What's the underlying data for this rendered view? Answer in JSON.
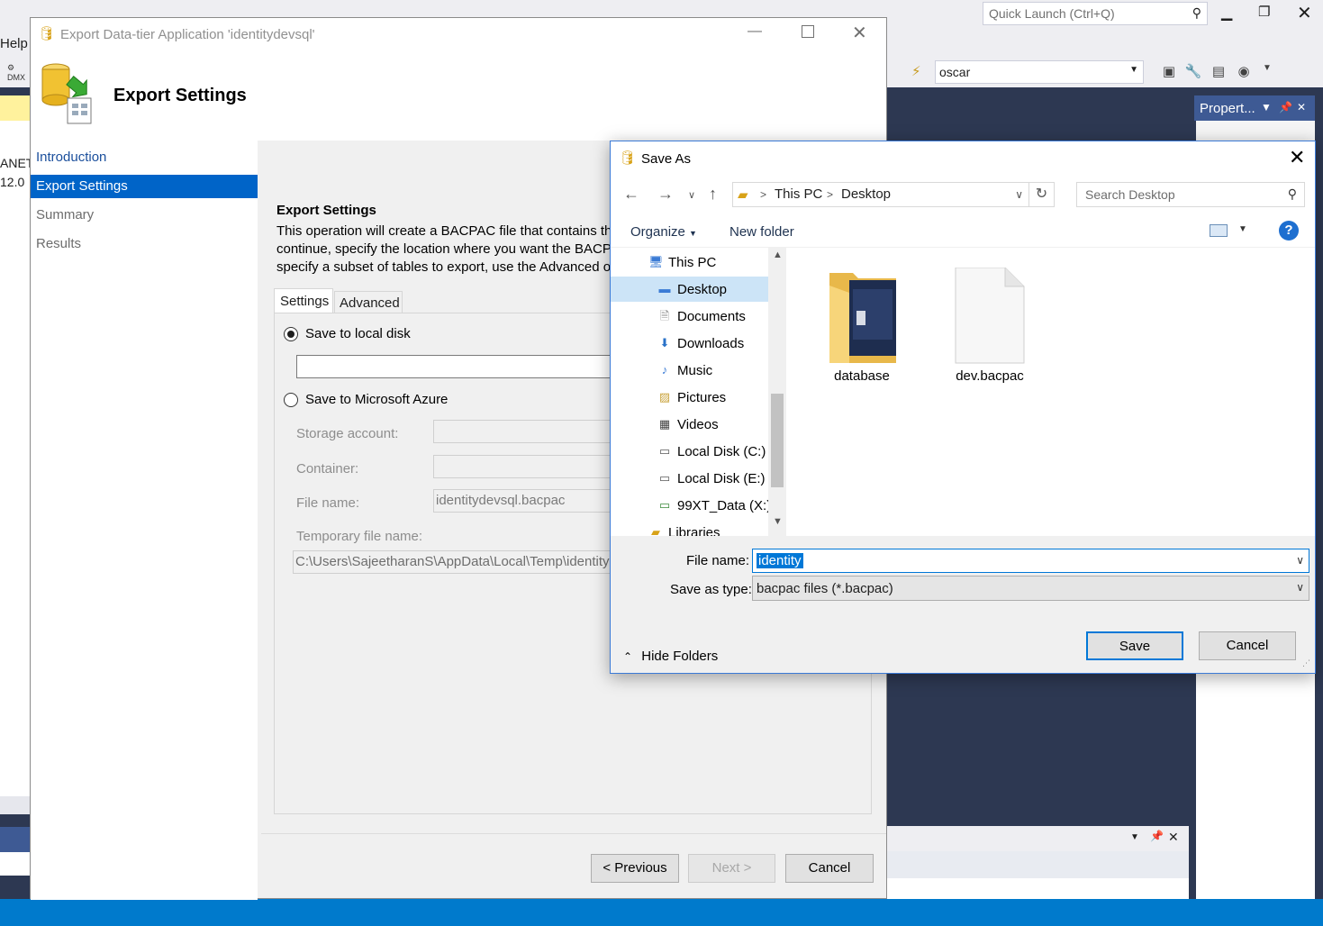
{
  "vs": {
    "help_menu": "Help",
    "quick_launch_placeholder": "Quick Launch (Ctrl+Q)",
    "connection_value": "oscar",
    "properties_title": "Propert...",
    "left_partial_1": "ANET",
    "left_partial_2": "12.0"
  },
  "wizard": {
    "title": "Export Data-tier Application 'identitydevsql'",
    "heading": "Export Settings",
    "nav": [
      "Introduction",
      "Export Settings",
      "Summary",
      "Results"
    ],
    "section_title": "Export Settings",
    "description_lines": [
      "This operation will create a BACPAC file that contains the",
      "continue, specify the location where you want the BACPA",
      "specify a subset of tables to export, use the Advanced op"
    ],
    "tabs": [
      "Settings",
      "Advanced"
    ],
    "local_disk_label": "Save to local disk",
    "local_disk_path": "",
    "azure_label": "Save to Microsoft Azure",
    "storage_account_label": "Storage account:",
    "container_label": "Container:",
    "file_name_label": "File name:",
    "file_name_value": "identitydevsql.bacpac",
    "temp_file_label": "Temporary file name:",
    "temp_file_value": "C:\\Users\\SajeetharanS\\AppData\\Local\\Temp\\identity",
    "buttons": {
      "previous": "< Previous",
      "next": "Next >",
      "cancel": "Cancel"
    }
  },
  "save_as": {
    "title": "Save As",
    "breadcrumb": [
      "This PC",
      "Desktop"
    ],
    "search_placeholder": "Search Desktop",
    "organize": "Organize",
    "new_folder": "New folder",
    "help": "?",
    "tree": [
      {
        "label": "This PC",
        "icon": "computer-icon",
        "indent": 0
      },
      {
        "label": "Desktop",
        "icon": "desktop-icon",
        "indent": 1,
        "selected": true
      },
      {
        "label": "Documents",
        "icon": "documents-icon",
        "indent": 1
      },
      {
        "label": "Downloads",
        "icon": "downloads-icon",
        "indent": 1
      },
      {
        "label": "Music",
        "icon": "music-icon",
        "indent": 1
      },
      {
        "label": "Pictures",
        "icon": "pictures-icon",
        "indent": 1
      },
      {
        "label": "Videos",
        "icon": "videos-icon",
        "indent": 1
      },
      {
        "label": "Local Disk (C:)",
        "icon": "drive-icon",
        "indent": 1
      },
      {
        "label": "Local Disk (E:)",
        "icon": "drive-icon",
        "indent": 1
      },
      {
        "label": "99XT_Data (X:)",
        "icon": "network-drive-icon",
        "indent": 1
      },
      {
        "label": "Libraries",
        "icon": "libraries-icon",
        "indent": 0
      }
    ],
    "files": [
      {
        "name": "database",
        "type": "folder"
      },
      {
        "name": "dev.bacpac",
        "type": "file"
      }
    ],
    "file_name_label": "File name:",
    "file_name_value": "identity",
    "save_type_label": "Save as type:",
    "save_type_value": "bacpac files (*.bacpac)",
    "hide_folders": "Hide Folders",
    "save_button": "Save",
    "cancel_button": "Cancel"
  },
  "colors": {
    "vs_dark": "#2d3852",
    "status_blue": "#007acc",
    "nav_selected": "#0064c8",
    "accent": "#0078d7"
  }
}
